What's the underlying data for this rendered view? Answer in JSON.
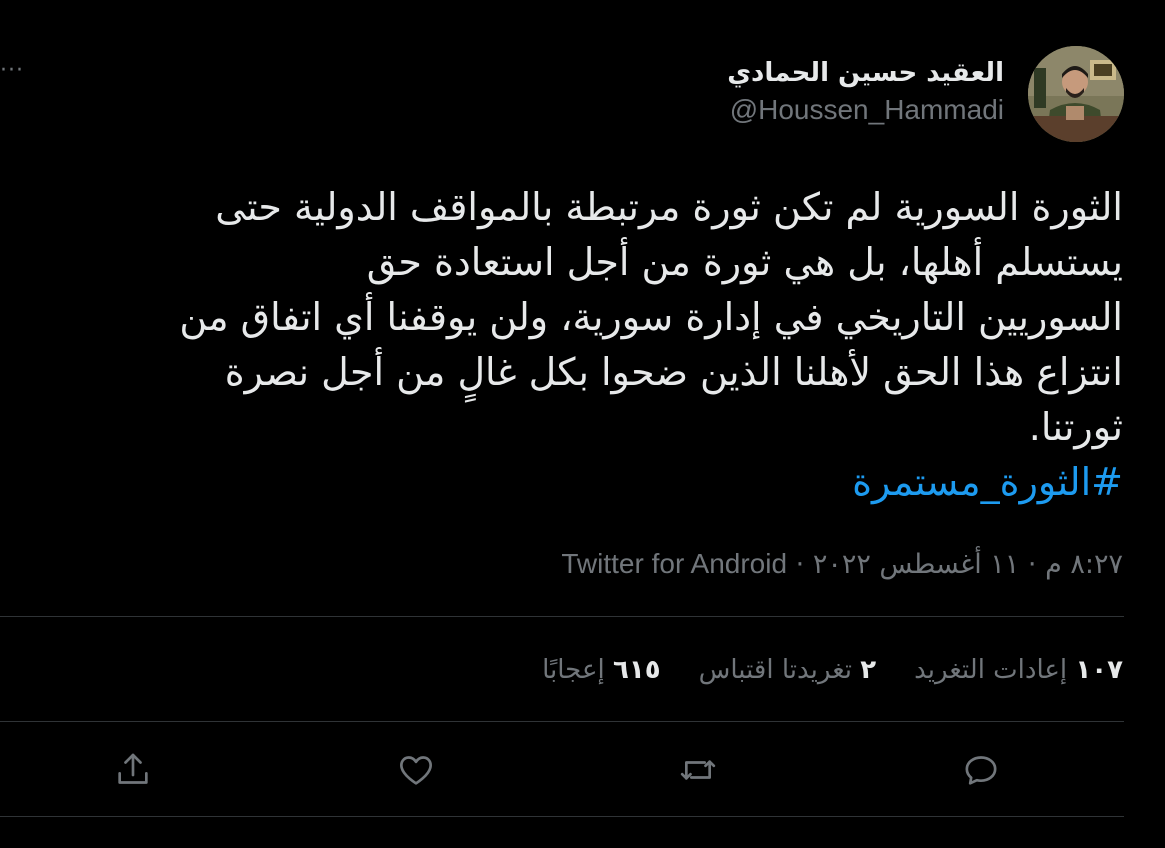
{
  "author": {
    "display_name": "العقيد حسين الحمادي",
    "handle": "@Houssen_Hammadi",
    "avatar_icon": "profile-photo"
  },
  "tweet": {
    "lines": [
      "الثورة السورية لم تكن ثورة مرتبطة بالمواقف الدولية حتى",
      "يستسلم أهلها، بل هي ثورة من أجل استعادة حق",
      "السوريين التاريخي في إدارة سورية، ولن يوقفنا أي اتفاق من",
      "انتزاع هذا الحق لأهلنا الذين ضحوا بكل غالٍ من أجل نصرة",
      "ثورتنا."
    ],
    "hashtag": "#الثورة_مستمرة"
  },
  "meta": {
    "time": "٨:٢٧ م",
    "date": "١١ أغسطس ٢٠٢٢",
    "separator": "·",
    "source": "Twitter for Android"
  },
  "stats": [
    {
      "num": "١٠٧",
      "label": "إعادات التغريد"
    },
    {
      "num": "٢",
      "label": "تغريدتا اقتباس"
    },
    {
      "num": "٦١٥",
      "label": "إعجابًا"
    }
  ],
  "more_label": "···",
  "actions": [
    "reply-icon",
    "retweet-icon",
    "like-icon",
    "share-icon"
  ],
  "colors": {
    "background": "#000000",
    "text": "#e7e9ea",
    "muted": "#71767b",
    "link": "#1d9bf0",
    "divider": "#2f3336"
  }
}
